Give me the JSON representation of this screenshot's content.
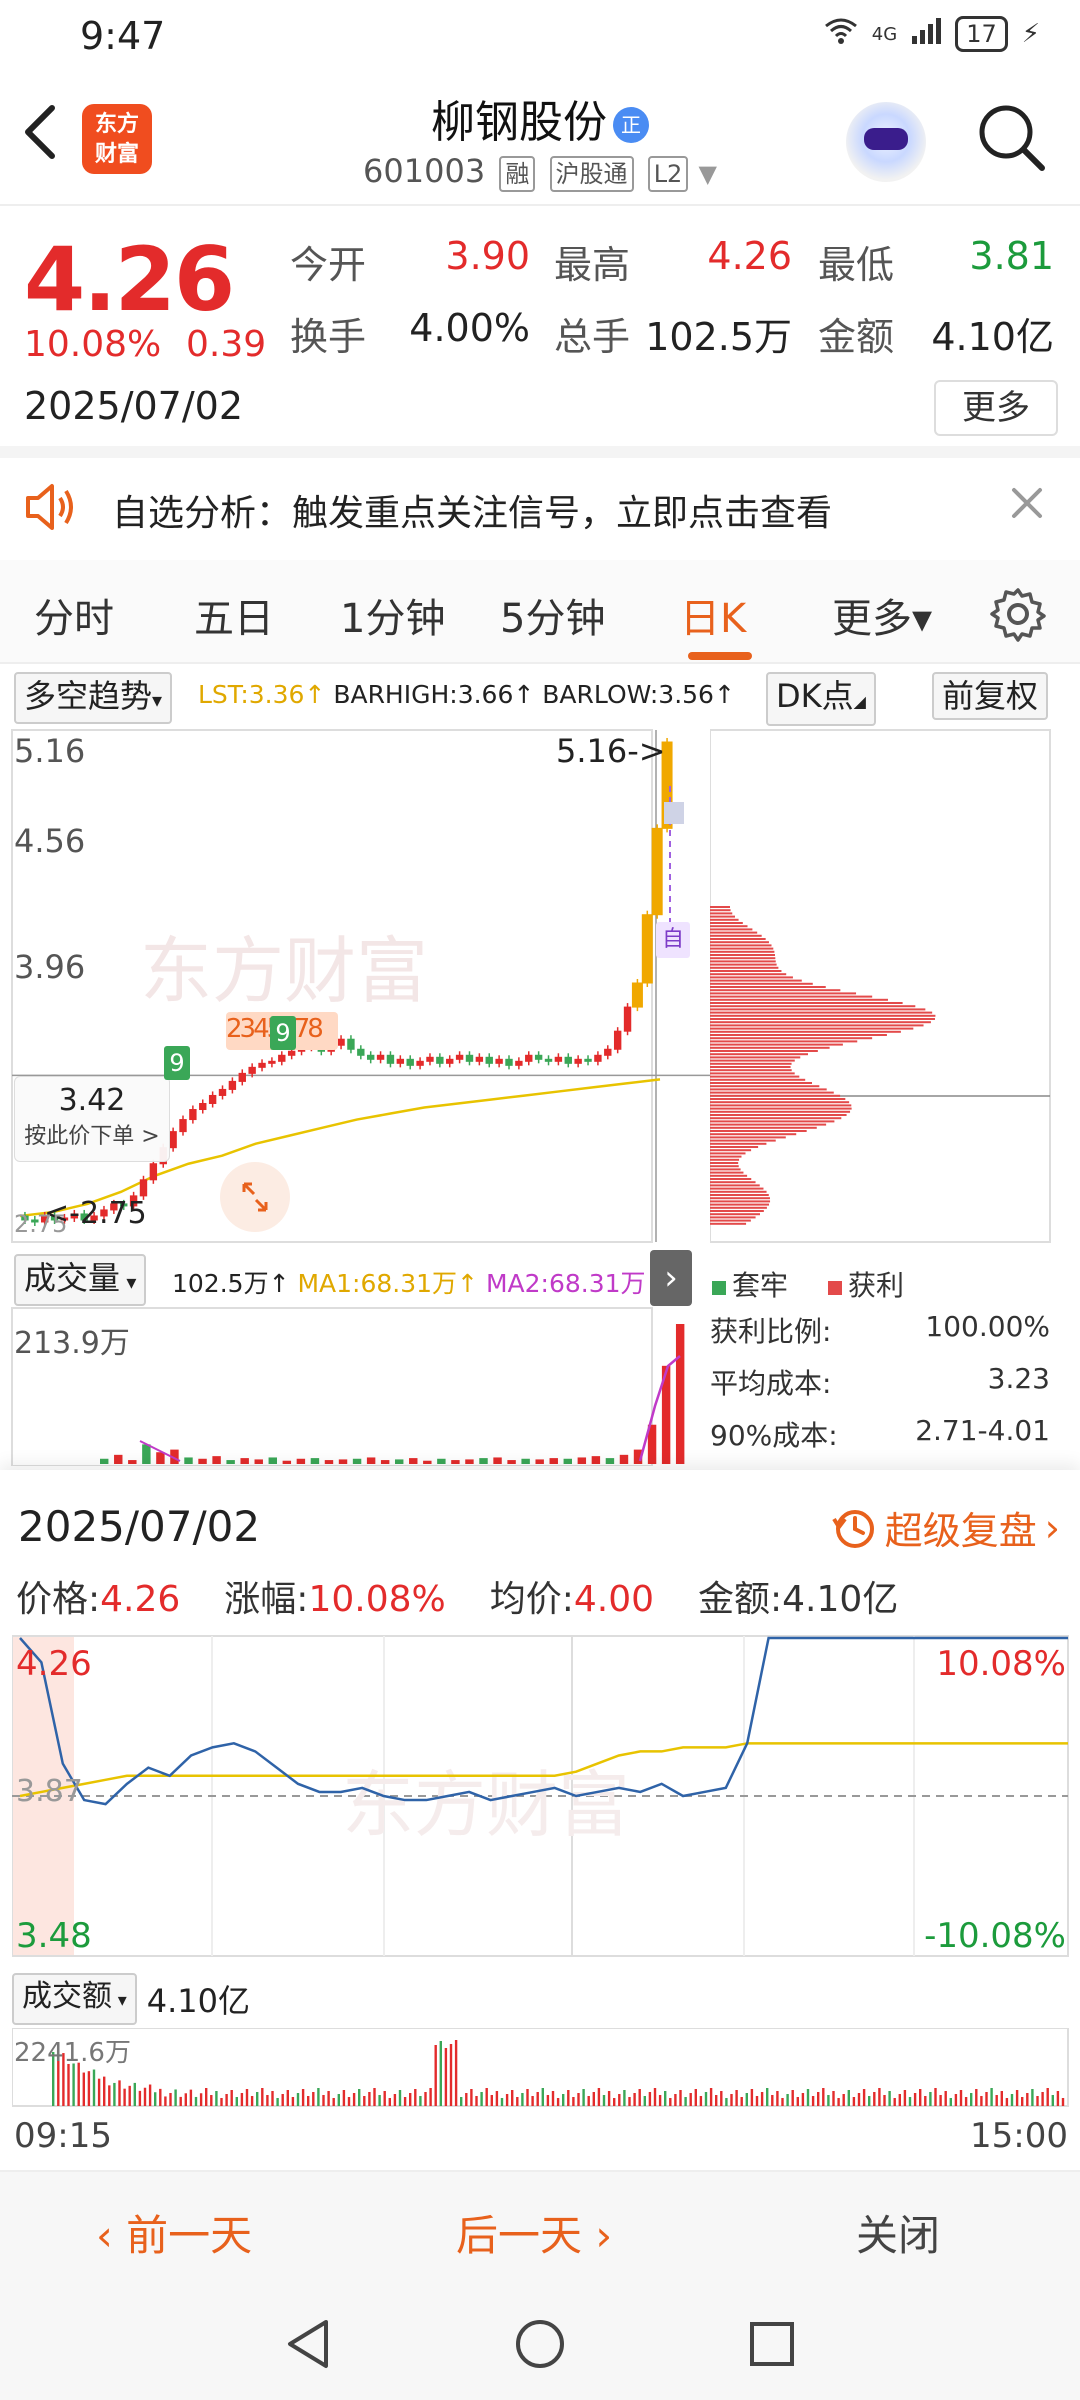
{
  "status": {
    "time": "9:47",
    "network": "4G",
    "battery": "17"
  },
  "header": {
    "logo_line1": "东方",
    "logo_line2": "财富",
    "stock_name": "柳钢股份",
    "badge": "正",
    "stock_code": "601003",
    "tags": [
      "融",
      "沪股通",
      "L2"
    ]
  },
  "quote": {
    "price": "4.26",
    "change_pct": "10.08%",
    "change": "0.39",
    "date": "2025/07/02",
    "open_label": "今开",
    "open": "3.90",
    "high_label": "最高",
    "high": "4.26",
    "low_label": "最低",
    "low": "3.81",
    "turnover_label": "换手",
    "turnover": "4.00%",
    "volume_label": "总手",
    "volume": "102.5万",
    "amount_label": "金额",
    "amount": "4.10亿",
    "more": "更多",
    "colors": {
      "up": "#e32b2b",
      "down": "#1c9b3c"
    }
  },
  "signal": {
    "text": "自选分析：触发重点关注信号，立即点击查看"
  },
  "tabs": [
    {
      "label": "分时"
    },
    {
      "label": "五日"
    },
    {
      "label": "1分钟"
    },
    {
      "label": "5分钟"
    },
    {
      "label": "日K",
      "active": true
    },
    {
      "label": "更多▾"
    }
  ],
  "indicator": {
    "name": "多空趋势",
    "lst": "LST:3.36↑",
    "barhigh": "BARHIGH:3.66↑",
    "barlow": "BARLOW:3.56↑",
    "dk_button": "DK点",
    "adjust_button": "前复权"
  },
  "kline": {
    "y_labels": [
      "5.16",
      "4.56",
      "3.96"
    ],
    "bottom_label": "2.75",
    "max_annotation": "5.16->",
    "min_annotation": "<-2.75",
    "crosshair_price": "3.42",
    "order_hint": "按此价下单 >",
    "td_counts": [
      "9",
      "2",
      "3",
      "4",
      "5",
      "6",
      "7",
      "8",
      "9"
    ],
    "self_marker": "自"
  },
  "volume_panel": {
    "name": "成交量",
    "vol": "102.5万↑",
    "ma1": "MA1:68.31万↑",
    "ma2": "MA2:68.31万↑",
    "top_label": "213.9万"
  },
  "chips": {
    "legend_trapped": "套牢",
    "legend_profit": "获利",
    "stats": [
      {
        "label": "获利比例:",
        "value": "100.00%"
      },
      {
        "label": "平均成本:",
        "value": "3.23"
      },
      {
        "label": "90%成本:",
        "value": "2.71-4.01"
      }
    ]
  },
  "replay": {
    "date": "2025/07/02",
    "link": "超级复盘",
    "price_label": "价格:",
    "price": "4.26",
    "pct_label": "涨幅:",
    "pct": "10.08%",
    "avg_label": "均价:",
    "avg": "4.00",
    "amount_label": "金额:",
    "amount": "4.10亿",
    "y_top": "4.26",
    "y_mid": "3.87",
    "y_bottom": "3.48",
    "pct_top": "10.08%",
    "pct_bottom": "-10.08%",
    "amount_panel": "成交额",
    "amount_total": "4.10亿",
    "amount_top": "2241.6万",
    "time_start": "09:15",
    "time_end": "15:00"
  },
  "footer": {
    "prev": "前一天",
    "next": "后一天",
    "close": "关闭"
  },
  "watermark": "东方财富",
  "chart_data": [
    {
      "type": "candlestick",
      "title": "",
      "y_ticks": [
        5.16,
        4.56,
        3.96
      ],
      "ylim": [
        2.75,
        5.16
      ],
      "candles": [
        {
          "o": 2.8,
          "c": 2.78
        },
        {
          "o": 2.78,
          "c": 2.77
        },
        {
          "o": 2.77,
          "c": 2.8
        },
        {
          "o": 2.8,
          "c": 2.78
        },
        {
          "o": 2.78,
          "c": 2.79
        },
        {
          "o": 2.79,
          "c": 2.81
        },
        {
          "o": 2.81,
          "c": 2.78
        },
        {
          "o": 2.78,
          "c": 2.8
        },
        {
          "o": 2.8,
          "c": 2.83
        },
        {
          "o": 2.83,
          "c": 2.86
        },
        {
          "o": 2.86,
          "c": 2.85
        },
        {
          "o": 2.85,
          "c": 2.9
        },
        {
          "o": 2.9,
          "c": 2.98
        },
        {
          "o": 2.98,
          "c": 3.06
        },
        {
          "o": 3.06,
          "c": 3.14
        },
        {
          "o": 3.14,
          "c": 3.22
        },
        {
          "o": 3.22,
          "c": 3.28
        },
        {
          "o": 3.28,
          "c": 3.33
        },
        {
          "o": 3.33,
          "c": 3.36
        },
        {
          "o": 3.36,
          "c": 3.4
        },
        {
          "o": 3.4,
          "c": 3.43
        },
        {
          "o": 3.43,
          "c": 3.47
        },
        {
          "o": 3.47,
          "c": 3.51
        },
        {
          "o": 3.51,
          "c": 3.54
        },
        {
          "o": 3.54,
          "c": 3.56
        },
        {
          "o": 3.56,
          "c": 3.57
        },
        {
          "o": 3.57,
          "c": 3.6
        },
        {
          "o": 3.6,
          "c": 3.62
        },
        {
          "o": 3.62,
          "c": 3.64
        },
        {
          "o": 3.64,
          "c": 3.66
        },
        {
          "o": 3.66,
          "c": 3.62
        },
        {
          "o": 3.62,
          "c": 3.65
        },
        {
          "o": 3.65,
          "c": 3.68
        },
        {
          "o": 3.68,
          "c": 3.63
        },
        {
          "o": 3.63,
          "c": 3.6
        },
        {
          "o": 3.6,
          "c": 3.58
        },
        {
          "o": 3.58,
          "c": 3.6
        },
        {
          "o": 3.6,
          "c": 3.56
        },
        {
          "o": 3.56,
          "c": 3.58
        },
        {
          "o": 3.58,
          "c": 3.55
        },
        {
          "o": 3.55,
          "c": 3.57
        },
        {
          "o": 3.57,
          "c": 3.59
        },
        {
          "o": 3.59,
          "c": 3.56
        },
        {
          "o": 3.56,
          "c": 3.58
        },
        {
          "o": 3.58,
          "c": 3.6
        },
        {
          "o": 3.6,
          "c": 3.57
        },
        {
          "o": 3.57,
          "c": 3.59
        },
        {
          "o": 3.59,
          "c": 3.56
        },
        {
          "o": 3.56,
          "c": 3.58
        },
        {
          "o": 3.58,
          "c": 3.55
        },
        {
          "o": 3.55,
          "c": 3.57
        },
        {
          "o": 3.57,
          "c": 3.6
        },
        {
          "o": 3.6,
          "c": 3.58
        },
        {
          "o": 3.58,
          "c": 3.57
        },
        {
          "o": 3.57,
          "c": 3.59
        },
        {
          "o": 3.59,
          "c": 3.56
        },
        {
          "o": 3.56,
          "c": 3.58
        },
        {
          "o": 3.58,
          "c": 3.57
        },
        {
          "o": 3.57,
          "c": 3.6
        },
        {
          "o": 3.6,
          "c": 3.63
        },
        {
          "o": 3.63,
          "c": 3.72
        },
        {
          "o": 3.72,
          "c": 3.84
        },
        {
          "o": 3.84,
          "c": 3.96
        },
        {
          "o": 3.96,
          "c": 4.3
        },
        {
          "o": 4.3,
          "c": 4.73
        },
        {
          "o": 4.73,
          "c": 5.16
        }
      ],
      "ma_line": [
        2.8,
        2.82,
        2.86,
        2.92,
        3.0,
        3.06,
        3.1,
        3.16,
        3.2,
        3.24,
        3.28,
        3.31,
        3.34,
        3.36,
        3.38,
        3.4,
        3.42,
        3.44,
        3.46,
        3.48
      ]
    },
    {
      "type": "bar",
      "title": "",
      "top_label_value": 213.9,
      "values": [
        8,
        14,
        6,
        30,
        18,
        22,
        10,
        8,
        12,
        6,
        9,
        7,
        10,
        5,
        8,
        9,
        6,
        7,
        8,
        10,
        6,
        7,
        9,
        5,
        8,
        6,
        7,
        9,
        10,
        6,
        8,
        7,
        9,
        8,
        10,
        12,
        9,
        14,
        22,
        60,
        150,
        213.9
      ]
    },
    {
      "type": "line",
      "title": "",
      "ylim": [
        3.48,
        4.26
      ],
      "price": [
        4.26,
        4.2,
        3.95,
        3.86,
        3.85,
        3.9,
        3.94,
        3.92,
        3.97,
        3.99,
        4.0,
        3.98,
        3.94,
        3.9,
        3.88,
        3.88,
        3.89,
        3.87,
        3.86,
        3.86,
        3.87,
        3.88,
        3.86,
        3.87,
        3.88,
        3.89,
        3.87,
        3.88,
        3.89,
        3.88,
        3.9,
        3.87,
        3.88,
        3.89,
        4.0,
        4.26,
        4.26,
        4.26,
        4.26,
        4.26,
        4.26,
        4.26,
        4.26,
        4.26,
        4.26,
        4.26,
        4.26,
        4.26,
        4.26,
        4.26
      ],
      "avg": [
        3.87,
        3.88,
        3.89,
        3.9,
        3.91,
        3.92,
        3.92,
        3.92,
        3.92,
        3.92,
        3.92,
        3.92,
        3.92,
        3.92,
        3.92,
        3.92,
        3.92,
        3.92,
        3.92,
        3.92,
        3.92,
        3.92,
        3.92,
        3.92,
        3.92,
        3.92,
        3.93,
        3.95,
        3.97,
        3.98,
        3.98,
        3.99,
        3.99,
        3.99,
        4.0,
        4.0,
        4.0,
        4.0,
        4.0,
        4.0,
        4.0,
        4.0,
        4.0,
        4.0,
        4.0,
        4.0,
        4.0,
        4.0,
        4.0,
        4.0
      ]
    }
  ]
}
